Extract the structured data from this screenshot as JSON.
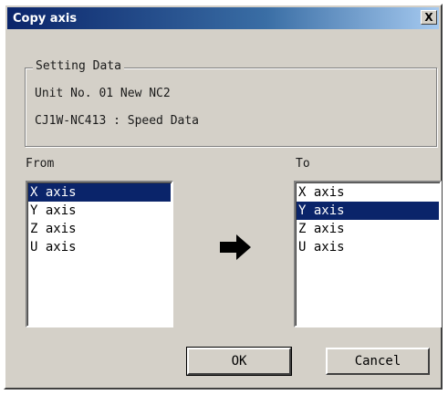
{
  "window": {
    "title": "Copy axis",
    "close_label": "X"
  },
  "setting": {
    "legend": "Setting Data",
    "unit_line": "Unit No. 01 New NC2",
    "model_line": "CJ1W-NC413 : Speed Data"
  },
  "from": {
    "label": "From",
    "items": [
      "X axis",
      "Y axis",
      "Z axis",
      "U axis"
    ],
    "selected": "X axis"
  },
  "to": {
    "label": "To",
    "items": [
      "X axis",
      "Y axis",
      "Z axis",
      "U axis"
    ],
    "selected": "Y axis"
  },
  "icons": {
    "copy_direction": "right-arrow-icon"
  },
  "buttons": {
    "ok": "OK",
    "cancel": "Cancel"
  },
  "colors": {
    "selection": "#0a246a",
    "dialog_face": "#d4d0c8"
  }
}
